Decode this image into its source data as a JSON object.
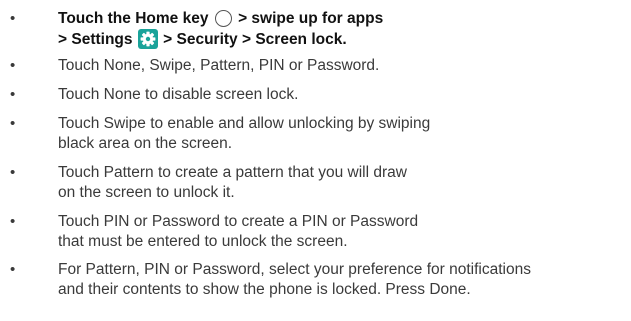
{
  "bullet_glyph": "•",
  "steps": [
    {
      "bold": true,
      "line1_a": "Touch the Home key",
      "line1_b": "> swipe up for apps",
      "line2_a": "> Settings",
      "line2_b": "> Security > Screen lock.",
      "icons": [
        "home-key-icon",
        "settings-gear-icon"
      ],
      "settings_icon_color": "#1aa39a"
    },
    {
      "lines": [
        "Touch None, Swipe, Pattern, PIN or Password."
      ]
    },
    {
      "lines": [
        "Touch None to disable screen lock."
      ]
    },
    {
      "lines": [
        "Touch Swipe to enable and allow unlocking by swiping",
        "black area on the screen."
      ]
    },
    {
      "lines": [
        "Touch Pattern to create a pattern that you will draw",
        "on the screen to unlock it."
      ]
    },
    {
      "lines": [
        "Touch PIN or Password to create a PIN or Password",
        "that must be entered to unlock the screen."
      ]
    },
    {
      "lines": [
        "For Pattern, PIN or Password, select your preference for notifications",
        "and their contents to show the phone is locked. Press Done."
      ]
    }
  ]
}
